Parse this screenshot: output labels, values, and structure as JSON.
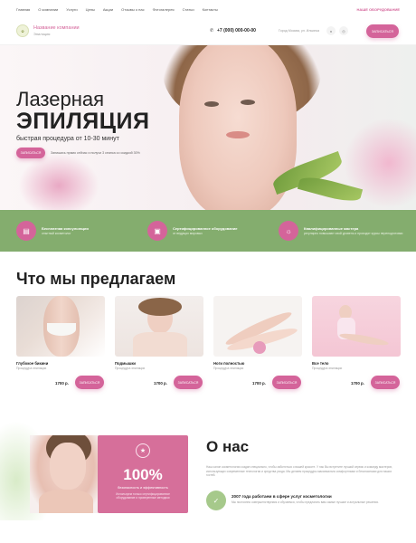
{
  "topnav": {
    "items": [
      "Главная",
      "О компании",
      "Услуги",
      "Цены",
      "Акции",
      "Отзывы о нас",
      "Фотогалерея",
      "Статьи",
      "Контакты"
    ],
    "cta": "НАШЕ ОБОРУДОВАНИЕ"
  },
  "header": {
    "company_name": "Название компании",
    "company_sub": "Эпиляция",
    "phone": "+7 (000) 000-00-00",
    "address": "Город Москва, ул. Ильинка",
    "button": "ЗАПИСАТЬСЯ"
  },
  "hero": {
    "title1": "Лазерная",
    "title2": "ЭПИЛЯЦИЯ",
    "subtitle": "быстрая процедура от 10-30 минут",
    "button": "ЗАПИСАТЬСЯ",
    "note": "Запишись прямо сейчас и получи 3 сеанса со скидкой 30%"
  },
  "features": [
    {
      "title": "Бесплатная консультация",
      "sub": "опытный косметолог",
      "icon": "document-icon"
    },
    {
      "title": "Сертифицированное оборудование",
      "sub": "от ведущих мировых",
      "icon": "monitor-icon"
    },
    {
      "title": "Квалифицированные мастера",
      "sub": "регулярно повышают свой уровень и проходят курсы переподготовки",
      "icon": "lightbulb-icon"
    }
  ],
  "services": {
    "title": "Что мы предлагаем",
    "cards": [
      {
        "name": "Глубокое бикини",
        "sub": "Процедура эпиляции",
        "price": "1700 р.",
        "button": "ЗАПИСАТЬСЯ"
      },
      {
        "name": "Подмышки",
        "sub": "Процедура эпиляции",
        "price": "1700 р.",
        "button": "ЗАПИСАТЬСЯ"
      },
      {
        "name": "Ноги полностью",
        "sub": "Процедура эпиляции",
        "price": "1700 р.",
        "button": "ЗАПИСАТЬСЯ"
      },
      {
        "name": "Все тело",
        "sub": "Процедура эпиляции",
        "price": "1700 р.",
        "button": "ЗАПИСАТЬСЯ"
      }
    ]
  },
  "about": {
    "percent": "100%",
    "percent_sub": "безопасность и эффективность",
    "percent_desc": "Используем только сертифицированное оборудование и проверенные методики",
    "title": "О нас",
    "text": "Наш салон косметологии создан специально, чтобы заботиться о вашей красоте. У нас Вы встретите лучший сервис и команду мастеров, использующих современные технологии и средства ухода. Мы делаем процедуры максимально комфортными и безопасными для наших гостей.",
    "line": "2007 года работаем в сфере услуг косметологии",
    "line_sub": "Мы постоянно совершенствуемся и обучаемся, чтобы предлагать вам самые лучшие и актуальные решения."
  },
  "colors": {
    "accent": "#d4649a",
    "green": "#84ad6e"
  }
}
